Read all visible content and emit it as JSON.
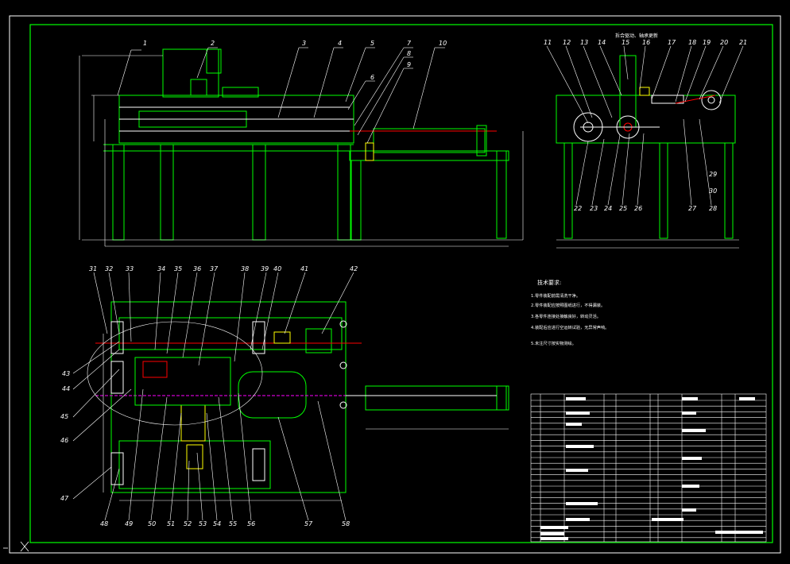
{
  "drawing": {
    "colors": {
      "frame": "#00ff00",
      "outline": "#ffffff",
      "hatch": "#ff00ff",
      "accent_red": "#ff0000",
      "accent_yellow": "#ffff00",
      "accent_cyan": "#00ffff",
      "background": "#000000"
    },
    "section_view_title": "拆合驱动、轴承更新",
    "technical_requirements": {
      "title": "技术要求:",
      "lines": [
        "1.零件装配前需清洗干净。",
        "2.零件装配应按照图纸进行，不得漏装。",
        "3.各零件连接处接触良好，转动灵活。",
        "4.装配后应进行空运转试验，无异常声响。",
        "5.未注尺寸按实物测绘。"
      ]
    },
    "top_labels": [
      "1",
      "2",
      "3",
      "4",
      "5",
      "6",
      "7",
      "8",
      "9",
      "10"
    ],
    "side_labels": [
      "11",
      "12",
      "13",
      "14",
      "15",
      "16",
      "17",
      "18",
      "19",
      "20",
      "21",
      "22",
      "23",
      "24",
      "25",
      "26",
      "27",
      "28",
      "29",
      "30"
    ],
    "plan_top_labels": [
      "31",
      "32",
      "33",
      "34",
      "35",
      "36",
      "37",
      "38",
      "39",
      "40",
      "41",
      "42"
    ],
    "plan_left_labels": [
      "43",
      "44",
      "45",
      "46",
      "47"
    ],
    "plan_bottom_labels": [
      "48",
      "49",
      "50",
      "51",
      "52",
      "53",
      "54",
      "55",
      "56",
      "57",
      "58"
    ]
  }
}
